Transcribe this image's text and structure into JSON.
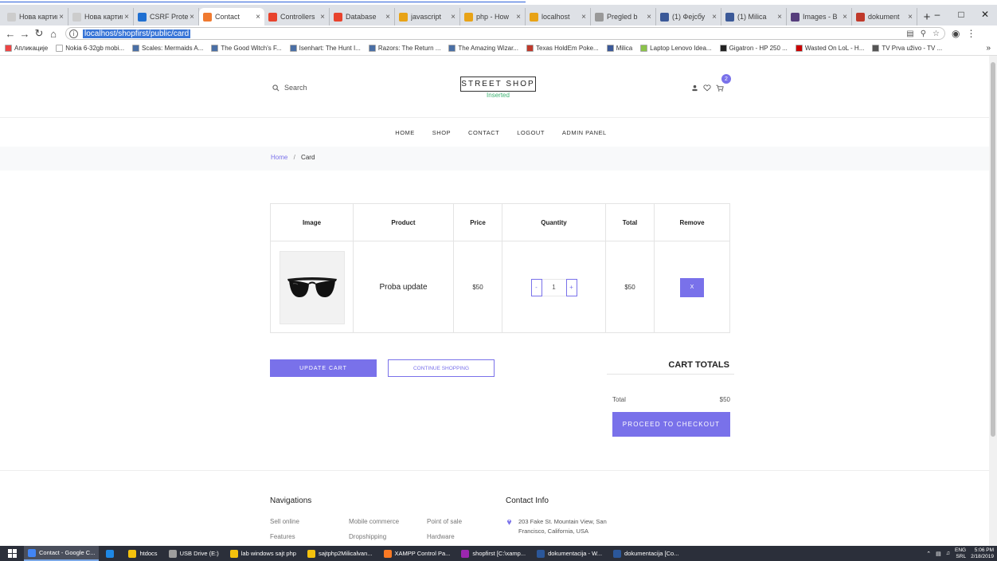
{
  "browser": {
    "tabs": [
      {
        "label": "Нова картица",
        "color": "#cccccc",
        "active": false
      },
      {
        "label": "Нова картица",
        "color": "#cccccc",
        "active": false
      },
      {
        "label": "CSRF Prote",
        "color": "#1f6fd1",
        "active": false
      },
      {
        "label": "Contact",
        "color": "#f07a30",
        "active": true
      },
      {
        "label": "Controllers",
        "color": "#e8432d",
        "active": false
      },
      {
        "label": "Database",
        "color": "#e8432d",
        "active": false
      },
      {
        "label": "javascript",
        "color": "#e8a317",
        "active": false
      },
      {
        "label": "php - How",
        "color": "#e8a317",
        "active": false
      },
      {
        "label": "localhost",
        "color": "#e8a317",
        "active": false
      },
      {
        "label": "Pregled b",
        "color": "#999999",
        "active": false
      },
      {
        "label": "(1) Фејсбу",
        "color": "#3b5998",
        "active": false
      },
      {
        "label": "(1) Milica",
        "color": "#3b5998",
        "active": false
      },
      {
        "label": "Images - B",
        "color": "#563d7c",
        "active": false
      },
      {
        "label": "dokument",
        "color": "#c0392b",
        "active": false
      }
    ],
    "url": "localhost/shopfirst/public/card",
    "bookmarks": [
      {
        "label": "Апликације",
        "color": "#e44"
      },
      {
        "label": "Nokia 6-32gb mobi...",
        "color": "#ffffff"
      },
      {
        "label": "Scales: Mermaids A...",
        "color": "#4a6fa5"
      },
      {
        "label": "The Good Witch's F...",
        "color": "#4a6fa5"
      },
      {
        "label": "Isenhart: The Hunt I...",
        "color": "#4a6fa5"
      },
      {
        "label": "Razors: The Return ...",
        "color": "#4a6fa5"
      },
      {
        "label": "The Amazing Wizar...",
        "color": "#4a6fa5"
      },
      {
        "label": "Texas HoldEm Poke...",
        "color": "#c0392b"
      },
      {
        "label": "Milica",
        "color": "#3b5998"
      },
      {
        "label": "Laptop Lenovo Idea...",
        "color": "#8bc34a"
      },
      {
        "label": "Gigatron - HP 250 ...",
        "color": "#222222"
      },
      {
        "label": "Wasted On LoL - H...",
        "color": "#cc0000"
      },
      {
        "label": "TV Prva uživo - TV ...",
        "color": "#555555"
      }
    ]
  },
  "site": {
    "search_label": "Search",
    "logo": "STREET SHOP",
    "flash": "Inserted",
    "cart_count": "2",
    "nav": [
      "HOME",
      "SHOP",
      "CONTACT",
      "LOGOUT",
      "ADMIN PANEL"
    ],
    "breadcrumb": {
      "home": "Home",
      "separator": "/",
      "current": "Card"
    },
    "table_headers": [
      "Image",
      "Product",
      "Price",
      "Quantity",
      "Total",
      "Remove"
    ],
    "cart_items": [
      {
        "product": "Proba update",
        "price": "$50",
        "quantity": "1",
        "total": "$50",
        "remove_label": "X",
        "minus": "-",
        "plus": "+"
      }
    ],
    "update_cart": "UPDATE CART",
    "continue_shopping": "CONTINUE SHOPPING",
    "totals_title": "CART TOTALS",
    "total_label": "Total",
    "total_value": "$50",
    "checkout": "PROCEED TO CHECKOUT",
    "footer": {
      "nav_title": "Navigations",
      "links": [
        "Sell online",
        "Mobile commerce",
        "Point of sale",
        "Features",
        "Dropshipping",
        "Hardware"
      ],
      "contact_title": "Contact Info",
      "address_line1": "203 Fake St. Mountain View, San",
      "address_line2": "Francisco, California, USA"
    },
    "accent": "#7971ea"
  },
  "taskbar": {
    "items": [
      {
        "label": "Contact - Google C...",
        "color": "#4285f4",
        "active": true
      },
      {
        "label": "",
        "color": "#1e88e5",
        "active": false
      },
      {
        "label": "htdocs",
        "color": "#f4c20d",
        "active": false
      },
      {
        "label": "USB Drive (E:)",
        "color": "#9e9e9e",
        "active": false
      },
      {
        "label": "lab windows sajt php",
        "color": "#f4c20d",
        "active": false
      },
      {
        "label": "sajtphp2Milicalvan...",
        "color": "#f4c20d",
        "active": false
      },
      {
        "label": "XAMPP Control Pa...",
        "color": "#fb7a24",
        "active": false
      },
      {
        "label": "shopfirst [C:\\xamp...",
        "color": "#9c27b0",
        "active": false
      },
      {
        "label": "dokumentacija - W...",
        "color": "#2b579a",
        "active": false
      },
      {
        "label": "dokumentacija [Co...",
        "color": "#2b579a",
        "active": false
      }
    ],
    "lang": "ENG",
    "lang_sub": "SRL",
    "time": "5:06 PM",
    "date": "2/18/2019"
  }
}
